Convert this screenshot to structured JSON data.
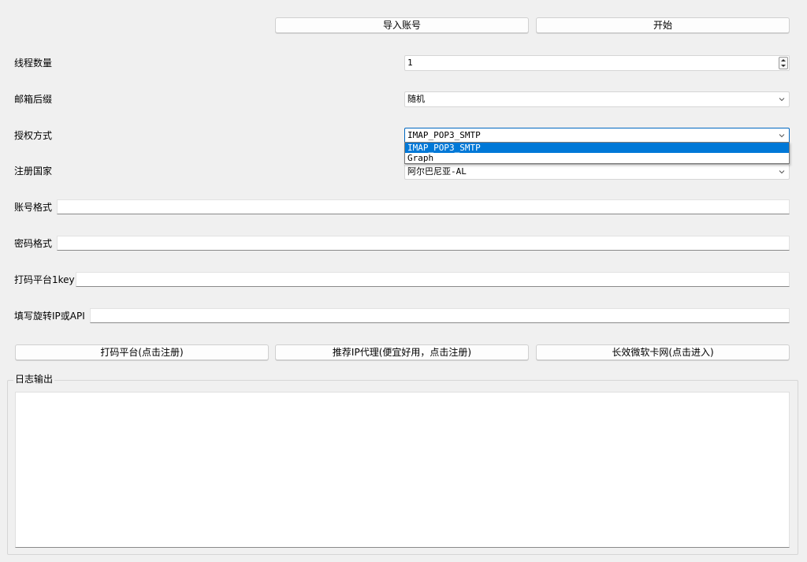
{
  "top_buttons": {
    "import_label": "导入账号",
    "start_label": "开始"
  },
  "form": {
    "thread_count": {
      "label": "线程数量",
      "value": "1"
    },
    "email_suffix": {
      "label": "邮箱后缀",
      "value": "随机"
    },
    "auth_method": {
      "label": "授权方式",
      "value": "IMAP_POP3_SMTP",
      "options": [
        "IMAP_POP3_SMTP",
        "Graph"
      ]
    },
    "country": {
      "label": "注册国家",
      "value": "阿尔巴尼亚-AL"
    },
    "account_format": {
      "label": "账号格式",
      "value": ""
    },
    "password_format": {
      "label": "密码格式",
      "value": ""
    },
    "captcha_key": {
      "label": "打码平台1key",
      "value": ""
    },
    "proxy": {
      "label": "填写旋转IP或API",
      "value": ""
    }
  },
  "bottom_buttons": {
    "captcha_platform": "打码平台(点击注册)",
    "ip_proxy": "推荐IP代理(便宜好用，点击注册)",
    "card_site": "长效微软卡网(点击进入)"
  },
  "log": {
    "title": "日志输出",
    "content": ""
  },
  "colors": {
    "accent": "#0078d7",
    "background": "#f0f0f0"
  },
  "icons": {
    "dropdown": "chevron-down-icon",
    "spin_up": "arrow-up-icon",
    "spin_down": "arrow-down-icon"
  }
}
